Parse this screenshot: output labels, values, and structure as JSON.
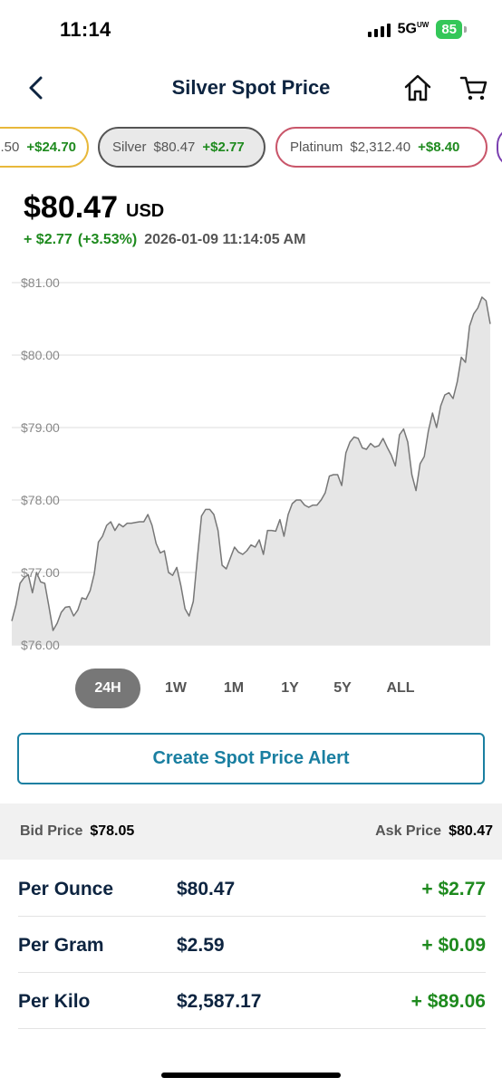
{
  "status_bar": {
    "time": "11:14",
    "network": "5G",
    "network_sup": "UW",
    "battery": "85"
  },
  "header": {
    "title": "Silver Spot Price"
  },
  "tickers": [
    {
      "name": "",
      "price": ".50",
      "change": "+$24.70",
      "color": "#e8b83a"
    },
    {
      "name": "Silver",
      "price": "$80.47",
      "change": "+$2.77",
      "color": "#555555"
    },
    {
      "name": "Platinum",
      "price": "$2,312.40",
      "change": "+$8.40",
      "color": "#c9566a"
    }
  ],
  "price": {
    "value": "$80.47",
    "currency": "USD",
    "change": "+ $2.77",
    "change_pct": "(+3.53%)",
    "timestamp": "2026-01-09 11:14:05 AM"
  },
  "chart_data": {
    "type": "area",
    "yticks": [
      "$81.00",
      "$80.00",
      "$79.00",
      "$78.00",
      "$77.00",
      "$76.00"
    ],
    "ylim": [
      76.0,
      81.0
    ],
    "grid": true,
    "y": [
      76.33,
      76.55,
      76.85,
      76.93,
      76.97,
      76.72,
      77.0,
      76.87,
      76.85,
      76.53,
      76.2,
      76.3,
      76.45,
      76.52,
      76.53,
      76.4,
      76.48,
      76.65,
      76.63,
      76.75,
      76.98,
      77.42,
      77.5,
      77.65,
      77.7,
      77.58,
      77.67,
      77.63,
      77.68,
      77.68,
      77.69,
      77.7,
      77.7,
      77.8,
      77.65,
      77.4,
      77.27,
      77.3,
      77.0,
      76.96,
      77.07,
      76.82,
      76.5,
      76.4,
      76.6,
      77.2,
      77.78,
      77.87,
      77.87,
      77.8,
      77.58,
      77.1,
      77.05,
      77.2,
      77.35,
      77.28,
      77.25,
      77.3,
      77.38,
      77.35,
      77.45,
      77.25,
      77.58,
      77.58,
      77.57,
      77.73,
      77.5,
      77.8,
      77.95,
      78.0,
      78.0,
      77.93,
      77.9,
      77.93,
      77.93,
      78.0,
      78.1,
      78.33,
      78.35,
      78.35,
      78.2,
      78.65,
      78.8,
      78.87,
      78.85,
      78.72,
      78.7,
      78.78,
      78.73,
      78.75,
      78.85,
      78.73,
      78.62,
      78.47,
      78.9,
      78.98,
      78.8,
      78.35,
      78.13,
      78.5,
      78.6,
      78.95,
      79.2,
      79.0,
      79.3,
      79.45,
      79.48,
      79.4,
      79.63,
      79.97,
      79.9,
      80.4,
      80.57,
      80.65,
      80.8,
      80.75,
      80.43
    ]
  },
  "ranges": [
    "24H",
    "1W",
    "1M",
    "1Y",
    "5Y",
    "ALL"
  ],
  "active_range": "24H",
  "alert_button": "Create Spot Price Alert",
  "bid_ask": {
    "bid_label": "Bid Price",
    "bid": "$78.05",
    "ask_label": "Ask Price",
    "ask": "$80.47"
  },
  "units": [
    {
      "label": "Per Ounce",
      "price": "$80.47",
      "change": "+ $2.77"
    },
    {
      "label": "Per Gram",
      "price": "$2.59",
      "change": "+ $0.09"
    },
    {
      "label": "Per Kilo",
      "price": "$2,587.17",
      "change": "+ $89.06"
    }
  ]
}
